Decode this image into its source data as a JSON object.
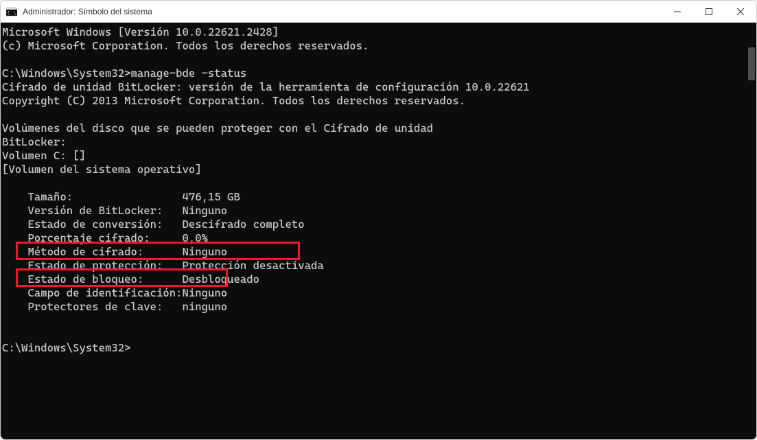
{
  "window": {
    "title": "Administrador: Símbolo del sistema"
  },
  "terminal": {
    "lines": {
      "l0": "Microsoft Windows [Versión 10.0.22621.2428]",
      "l1": "(c) Microsoft Corporation. Todos los derechos reservados.",
      "l2": "",
      "l3": "C:\\Windows\\System32>manage-bde -status",
      "l4": "Cifrado de unidad BitLocker: versión de la herramienta de configuración 10.0.22621",
      "l5": "Copyright (C) 2013 Microsoft Corporation. Todos los derechos reservados.",
      "l6": "",
      "l7": "Volúmenes del disco que se pueden proteger con el Cifrado de unidad",
      "l8": "BitLocker:",
      "l9": "Volumen C: []",
      "l10": "[Volumen del sistema operativo]",
      "l11": "",
      "l12": "    Tamaño:                 476,15 GB",
      "l13": "    Versión de BitLocker:   Ninguno",
      "l14": "    Estado de conversión:   Descifrado completo",
      "l15": "    Porcentaje cifrado:     0,0%",
      "l16": "    Método de cifrado:      Ninguno",
      "l17": "    Estado de protección:   Protección desactivada",
      "l18": "    Estado de bloqueo:      Desbloqueado",
      "l19": "    Campo de identificación:Ninguno",
      "l20": "    Protectores de clave:   ninguno",
      "l21": "",
      "l22": "",
      "l23": "C:\\Windows\\System32>"
    }
  }
}
